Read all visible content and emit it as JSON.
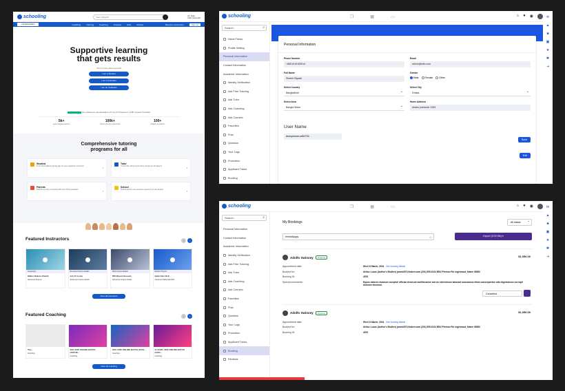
{
  "brand": "schooling",
  "p1": {
    "search_cat": "Tutor",
    "search_placeholder": "Search",
    "user_line1": "Hi, Tess",
    "user_line2": "Cart | Account",
    "nav": {
      "categories": "CATEGORIES",
      "items": [
        "Coaching",
        "Tutoring",
        "Coaching",
        "Courses",
        "Jobs",
        "Articles"
      ],
      "right": "Become a Instructor",
      "login": "Sign up"
    },
    "hero_title": "Supportive learning that gets results",
    "hero_sub": "Tell us more about yourself",
    "hero_buttons": [
      "I am a Student",
      "I am a Guardian",
      "I am an Institution"
    ],
    "trust": "Our customers say Excellent 4.5 out of 5 based on 1,000 reviews Trustpilot",
    "stats": [
      {
        "n": "5k+",
        "l": "years helping learners"
      },
      {
        "n": "100k+",
        "l": "Hours of 1-on-1 instruction"
      },
      {
        "n": "100+",
        "l": "subjects to explore"
      }
    ],
    "programs_title": "Comprehensive tutoring programs for all",
    "programs": [
      {
        "t": "Student",
        "d": "K-12, Personalized tutoring app for every academic curriculum"
      },
      {
        "t": "Tutor",
        "d": "Tutors offer efficient and online tutoring for all subjects"
      },
      {
        "t": "Parents",
        "d": "Parents can stay connected with their child's education"
      },
      {
        "t": "School",
        "d": "School partners can seamless resources for all students"
      }
    ],
    "instructors_title": "Featured Instructors",
    "instructors": [
      {
        "cap": "Geography",
        "t": "Walter Dakota Sheikh",
        "m": "Advanced Science"
      },
      {
        "cap": "Recorded Course Details",
        "t": "Ash D Cooks",
        "m": "Advanced Course Details"
      },
      {
        "cap": "Math Course Details",
        "t": "MD Masud Hossain",
        "m": "Advanced Course Details"
      },
      {
        "cap": "Modern Physics",
        "t": "Sabb Sam Bolt",
        "m": "Advanced Sabb Sam Bolt"
      }
    ],
    "instructors_more": "View all instructors",
    "coaching_title": "Featured Coaching",
    "coaching": [
      {
        "t": "Two",
        "m": "Coaching"
      },
      {
        "t": "SSC 2025 ONLINE BATCH (ANTHE...",
        "m": "Coaching"
      },
      {
        "t": "HSC 2025 ONLINE BATCH (GOO...",
        "m": "Coaching"
      },
      {
        "t": "O LEVEL 2025 ONLINE BATCH (GOO...",
        "m": "Coaching"
      }
    ],
    "coaching_more": "View all coaching"
  },
  "sidebar": {
    "search": "Search..",
    "items": [
      "News Feeds",
      "Profile Setting",
      "Personal Information",
      "Contact Information",
      "Academic Information",
      "Identity Verification",
      "Ask Free Tutoring",
      "Ask Tutor",
      "Ask Coaching",
      "Ask Courses",
      "Favorites",
      "Post",
      "Question",
      "Your Logs",
      "Promotion",
      "Applicant Tutors",
      "Booking"
    ]
  },
  "sidebar3": {
    "items": [
      "Personal Information",
      "Contact Information",
      "Academic Information",
      "Identity Verification",
      "Ask Free Tutoring",
      "Ask Tutor",
      "Ask Coaching",
      "Ask Courses",
      "Favorites",
      "Post",
      "Question",
      "Your Logs",
      "Promotion",
      "Applicant Tutors",
      "Booking",
      "Reviews"
    ]
  },
  "personal": {
    "title": "Personal Information",
    "phone_label": "Phone Number",
    "phone": "+8801919155914",
    "email_label": "Email",
    "email": "admin@edb.com",
    "fullname_label": "Full Name",
    "fullname": "Sheikh Riyadh",
    "gender_label": "Gender",
    "gender_options": [
      "Male",
      "Female",
      "Other"
    ],
    "country_label": "Select Country",
    "country": "Bangladesh",
    "city_label": "Select City",
    "city": "Dhaka",
    "area_label": "Select Area",
    "area": "Bangla Motor",
    "address_label": "Home Address",
    "address": "dhaka postcode 1264",
    "save": "Save",
    "username_label": "User Name",
    "username": "anonymous:ud54734",
    "edit": "Edit"
  },
  "bookings": {
    "title": "My Bookings",
    "status_filter": "All status",
    "date_placeholder": "mm/dd/yyyy",
    "export": "Export (CSV file)",
    "labels": {
      "date": "Appointment date:",
      "booked_for": "Booked for:",
      "id": "Booking ID:",
      "comments": "Special comments:"
    },
    "items": [
      {
        "name": "Adolfo Swinney",
        "status": "Ongoing",
        "amount": "$1,056.00",
        "date": "Wed 13 March, 2024",
        "link": "See booking details",
        "booked_for": "Arthur Lucas (Author's Brother) james007@tutorn.com (201) 555-0124 8502 Preston Rd. Inglewood, Maine 98380",
        "id": "#876",
        "comments": "Equos dolores eiusmod excepturi officiae deserunt mollitia animi sed an exterminum laborant accusamus etiam consequentur odio dignissimos corrupti dolorum eiusmod.",
        "select": "Cancelled"
      },
      {
        "name": "Adolfo Swinney",
        "status": "Ongoing",
        "amount": "$1,056.00",
        "date": "Wed 13 March, 2024",
        "link": "See booking details",
        "booked_for": "Arthur Lucas (Author's Brother) james007@tutorn.com (201) 555-0124 8502 Preston Rd. Inglewood, Maine 98380",
        "id": "#876"
      }
    ]
  }
}
